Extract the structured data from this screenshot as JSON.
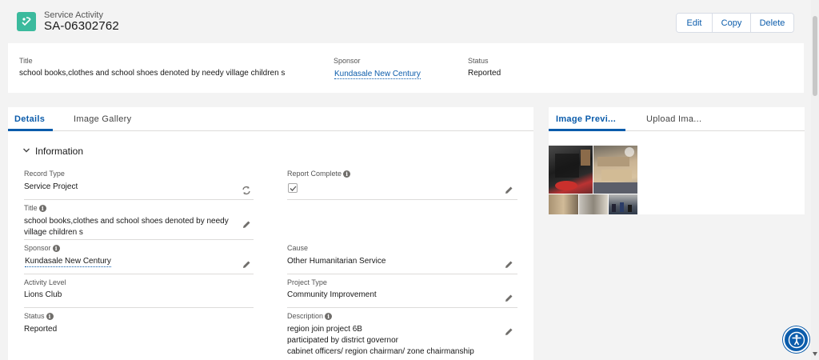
{
  "header": {
    "object_label": "Service Activity",
    "record_name": "SA-06302762",
    "actions": {
      "edit": "Edit",
      "copy": "Copy",
      "delete": "Delete"
    }
  },
  "highlights": {
    "title_label": "Title",
    "title_value": "school books,clothes and school shoes denoted by needy village children s",
    "sponsor_label": "Sponsor",
    "sponsor_value": "Kundasale New Century",
    "status_label": "Status",
    "status_value": "Reported"
  },
  "main_tabs": {
    "details": "Details",
    "gallery": "Image Gallery"
  },
  "section": {
    "title": "Information"
  },
  "fields": {
    "record_type": {
      "label": "Record Type",
      "value": "Service Project"
    },
    "report_complete": {
      "label": "Report Complete",
      "checked": true
    },
    "title": {
      "label": "Title",
      "value": "school books,clothes and school shoes denoted by needy village children s"
    },
    "sponsor": {
      "label": "Sponsor",
      "value": "Kundasale New Century"
    },
    "cause": {
      "label": "Cause",
      "value": "Other Humanitarian Service"
    },
    "activity_level": {
      "label": "Activity Level",
      "value": "Lions Club"
    },
    "project_type": {
      "label": "Project Type",
      "value": "Community Improvement"
    },
    "status": {
      "label": "Status",
      "value": "Reported"
    },
    "description": {
      "label": "Description",
      "lines": [
        "region join project 6B",
        "participated by district governor",
        "cabinet officers/ region chairman/ zone chairmanship"
      ]
    }
  },
  "preview_tabs": {
    "preview": "Image Previ...",
    "upload": "Upload Ima..."
  },
  "colors": {
    "brand": "#0b5cab",
    "object_icon": "#3bba9d"
  },
  "icons": [
    "service-activity-icon",
    "chevron-down-icon",
    "info-icon",
    "pencil-icon",
    "change-record-type-icon",
    "checkmark-icon",
    "accessibility-icon"
  ]
}
